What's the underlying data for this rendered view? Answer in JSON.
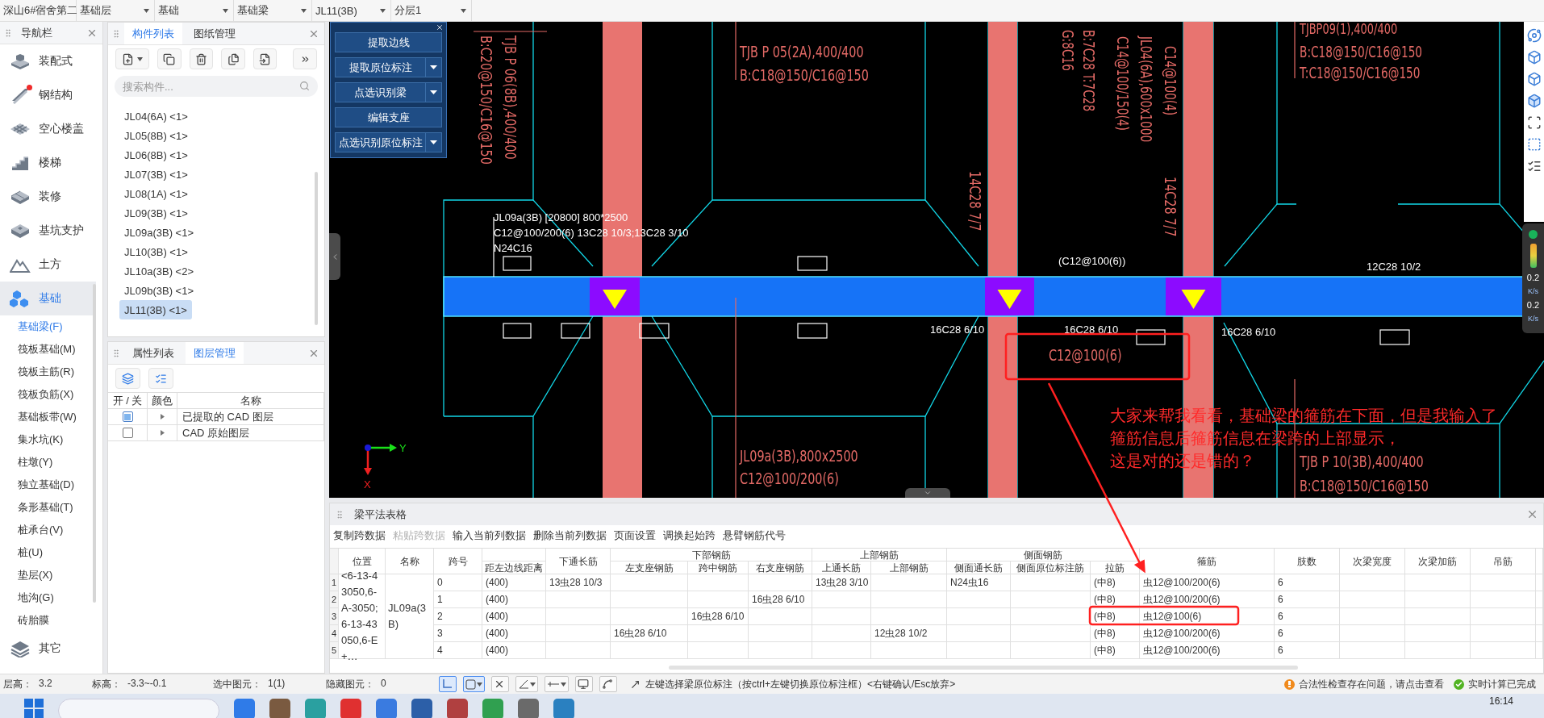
{
  "top_bar": {
    "selectors": [
      {
        "label": "深山6#宿舍第二"
      },
      {
        "label": "基础层"
      },
      {
        "label": "基础"
      },
      {
        "label": "基础梁"
      },
      {
        "label": "JL11(3B)"
      },
      {
        "label": "分层1"
      }
    ]
  },
  "nav": {
    "title": "导航栏",
    "items": [
      {
        "label": "装配式",
        "selected": false,
        "dot": false
      },
      {
        "label": "钢结构",
        "selected": false,
        "dot": true
      },
      {
        "label": "空心楼盖",
        "selected": false,
        "dot": false
      },
      {
        "label": "楼梯",
        "selected": false,
        "dot": false
      },
      {
        "label": "装修",
        "selected": false,
        "dot": false
      },
      {
        "label": "基坑支护",
        "selected": false,
        "dot": false
      },
      {
        "label": "土方",
        "selected": false,
        "dot": false
      },
      {
        "label": "基础",
        "selected": true,
        "dot": false,
        "children": [
          {
            "label": "基础梁(F)",
            "selected": true
          },
          {
            "label": "筏板基础(M)",
            "selected": false
          },
          {
            "label": "筏板主筋(R)",
            "selected": false
          },
          {
            "label": "筏板负筋(X)",
            "selected": false
          },
          {
            "label": "基础板带(W)",
            "selected": false
          },
          {
            "label": "集水坑(K)",
            "selected": false
          },
          {
            "label": "柱墩(Y)",
            "selected": false
          },
          {
            "label": "独立基础(D)",
            "selected": false
          },
          {
            "label": "条形基础(T)",
            "selected": false
          },
          {
            "label": "桩承台(V)",
            "selected": false
          },
          {
            "label": "桩(U)",
            "selected": false
          },
          {
            "label": "垫层(X)",
            "selected": false
          },
          {
            "label": "地沟(G)",
            "selected": false
          },
          {
            "label": "砖胎膜",
            "selected": false
          }
        ]
      },
      {
        "label": "其它",
        "selected": false,
        "dot": false
      }
    ]
  },
  "component_panel": {
    "tabs": [
      {
        "label": "构件列表",
        "selected": true
      },
      {
        "label": "图纸管理",
        "selected": false
      }
    ],
    "search": {
      "placeholder": "搜索构件..."
    },
    "items": [
      {
        "label": "JL04(6A) <1>",
        "selected": false
      },
      {
        "label": "JL05(8B) <1>",
        "selected": false
      },
      {
        "label": "JL06(8B) <1>",
        "selected": false
      },
      {
        "label": "JL07(3B) <1>",
        "selected": false
      },
      {
        "label": "JL08(1A) <1>",
        "selected": false
      },
      {
        "label": "JL09(3B) <1>",
        "selected": false
      },
      {
        "label": "JL09a(3B) <1>",
        "selected": false
      },
      {
        "label": "JL10(3B) <1>",
        "selected": false
      },
      {
        "label": "JL10a(3B) <2>",
        "selected": false
      },
      {
        "label": "JL09b(3B) <1>",
        "selected": false
      },
      {
        "label": "JL11(3B) <1>",
        "selected": true
      }
    ]
  },
  "layer_panel": {
    "tabs": [
      {
        "label": "属性列表",
        "selected": false
      },
      {
        "label": "图层管理",
        "selected": true
      }
    ],
    "columns": [
      "开 / 关",
      "颜色",
      "名称"
    ],
    "rows": [
      {
        "checked": true,
        "name": "已提取的 CAD 图层"
      },
      {
        "checked": false,
        "name": "CAD 原始图层"
      }
    ]
  },
  "canvas": {
    "tool_panel": {
      "buttons": [
        {
          "label": "提取边线",
          "has_menu": false
        },
        {
          "label": "提取原位标注",
          "has_menu": true
        },
        {
          "label": "点选识别梁",
          "has_menu": true
        },
        {
          "label": "编辑支座",
          "has_menu": false
        },
        {
          "label": "点选识别原位标注",
          "has_menu": true
        }
      ]
    },
    "texts": [
      {
        "text": "B:C20@150/C16@150",
        "kind": "plan"
      },
      {
        "text": "TJB P 06(8B),400/400",
        "kind": "plan"
      },
      {
        "text": "TJB P 05(2A),400/400",
        "kind": "plan"
      },
      {
        "text": "B:C18@150/C16@150",
        "kind": "plan"
      },
      {
        "text": "G:8C16",
        "kind": "plan"
      },
      {
        "text": "B:7C28 T:7C28",
        "kind": "plan"
      },
      {
        "text": "C14@100/150(4)",
        "kind": "plan"
      },
      {
        "text": "JL04(6A),600x1000",
        "kind": "plan"
      },
      {
        "text": "C14@100(4)",
        "kind": "plan"
      },
      {
        "text": "TJBP09(1),400/400",
        "kind": "plan"
      },
      {
        "text": "B:C18@150/C16@150",
        "kind": "plan"
      },
      {
        "text": "T:C18@150/C16@150",
        "kind": "plan"
      },
      {
        "text": "14C28 7/7",
        "kind": "plan"
      },
      {
        "text": "14C28 7/7",
        "kind": "plan"
      },
      {
        "text": "JL09a(3B) [20800] 800*2500",
        "kind": "beam"
      },
      {
        "text": "C12@100/200(6) 13C28 10/3;13C28 3/10",
        "kind": "beam"
      },
      {
        "text": "N24C16",
        "kind": "beam"
      },
      {
        "text": "(C12@100(6))",
        "kind": "beam"
      },
      {
        "text": "12C28 10/2",
        "kind": "beam"
      },
      {
        "text": "16C28 6/10",
        "kind": "beam"
      },
      {
        "text": "16C28 6/10",
        "kind": "beam"
      },
      {
        "text": "16C28 6/10",
        "kind": "beam"
      },
      {
        "text": "C12@100(6)",
        "kind": "plan"
      },
      {
        "text": "JL09a(3B),800x2500",
        "kind": "plan"
      },
      {
        "text": "C12@100/200(6)",
        "kind": "plan"
      },
      {
        "text": "TJB P 10(3B),400/400",
        "kind": "plan"
      },
      {
        "text": "B:C18@150/C16@150",
        "kind": "plan"
      }
    ],
    "note": {
      "lines": [
        "大家来帮我看看，基础梁的箍筋在下面，但是我输入了",
        "箍筋信息后箍筋信息在梁跨的上部显示，",
        "这是对的还是错的？"
      ]
    },
    "axis": {
      "y": "Y",
      "x": "X"
    },
    "network": {
      "upload": "0.2",
      "upload_unit": "K/s",
      "download": "0.2",
      "download_unit": "K/s"
    }
  },
  "table_panel": {
    "title": "梁平法表格",
    "actions": [
      {
        "label": "复制跨数据",
        "disabled": false
      },
      {
        "label": "粘贴跨数据",
        "disabled": true
      },
      {
        "label": "输入当前列数据",
        "disabled": false
      },
      {
        "label": "删除当前列数据",
        "disabled": false
      },
      {
        "label": "页面设置",
        "disabled": false
      },
      {
        "label": "调换起始跨",
        "disabled": false
      },
      {
        "label": "悬臂钢筋代号",
        "disabled": false
      }
    ],
    "groups": [
      "下部钢筋",
      "上部钢筋",
      "侧面钢筋"
    ],
    "columns": [
      "位置",
      "名称",
      "跨号",
      "距左边线距离",
      "下通长筋",
      "左支座钢筋",
      "跨中钢筋",
      "右支座钢筋",
      "上通长筋",
      "上部钢筋",
      "侧面通长筋",
      "侧面原位标注筋",
      "拉筋",
      "箍筋",
      "肢数",
      "次梁宽度",
      "次梁加筋",
      "吊筋"
    ],
    "location": "<6-13-43050,6-A-3050;6-13-43050,6-E+…",
    "name": "JL09a(3B)",
    "rows": [
      {
        "number": "1",
        "span": "0",
        "distance": "(400)",
        "bottom_through": "13虫28 10/3",
        "top_through": "13虫28 3/10",
        "side_through": "N24虫16",
        "tie": "(中8)",
        "stirrup": "虫12@100/200(6)",
        "legs": "6"
      },
      {
        "number": "2",
        "span": "1",
        "distance": "(400)",
        "right_support": "16虫28 6/10",
        "tie": "(中8)",
        "stirrup": "虫12@100/200(6)",
        "legs": "6"
      },
      {
        "number": "3",
        "span": "2",
        "distance": "(400)",
        "mid": "16虫28 6/10",
        "tie": "(中8)",
        "stirrup": "虫12@100(6)",
        "legs": "6"
      },
      {
        "number": "4",
        "span": "3",
        "distance": "(400)",
        "left_support": "16虫28 6/10",
        "top": "12虫28 10/2",
        "tie": "(中8)",
        "stirrup": "虫12@100/200(6)",
        "legs": "6"
      },
      {
        "number": "5",
        "span": "4",
        "distance": "(400)",
        "tie": "(中8)",
        "stirrup": "虫12@100/200(6)",
        "legs": "6"
      }
    ]
  },
  "status_bar": {
    "fields": [
      {
        "label": "层高：",
        "value": "3.2"
      },
      {
        "label": "标高：",
        "value": "-3.3~-0.1"
      },
      {
        "label": "选中图元：",
        "value": "1(1)"
      },
      {
        "label": "隐藏图元：",
        "value": "0"
      }
    ],
    "tools": [
      {
        "kind": "ortho",
        "selected": true
      },
      {
        "kind": "select",
        "selected": true
      },
      {
        "kind": "cross",
        "selected": false
      },
      {
        "kind": "angle",
        "selected": false
      },
      {
        "kind": "line",
        "selected": false
      },
      {
        "kind": "screen",
        "selected": false
      },
      {
        "kind": "arc",
        "selected": false
      }
    ],
    "hint": "左键选择梁原位标注（按ctrl+左键切换原位标注框）<右键确认/Esc放弃>",
    "alerts": [
      {
        "kind": "warning",
        "text": "合法性检查存在问题，请点击查看"
      },
      {
        "kind": "ok",
        "text": "实时计算已完成"
      }
    ]
  },
  "taskbar": {
    "time": "16:14"
  }
}
